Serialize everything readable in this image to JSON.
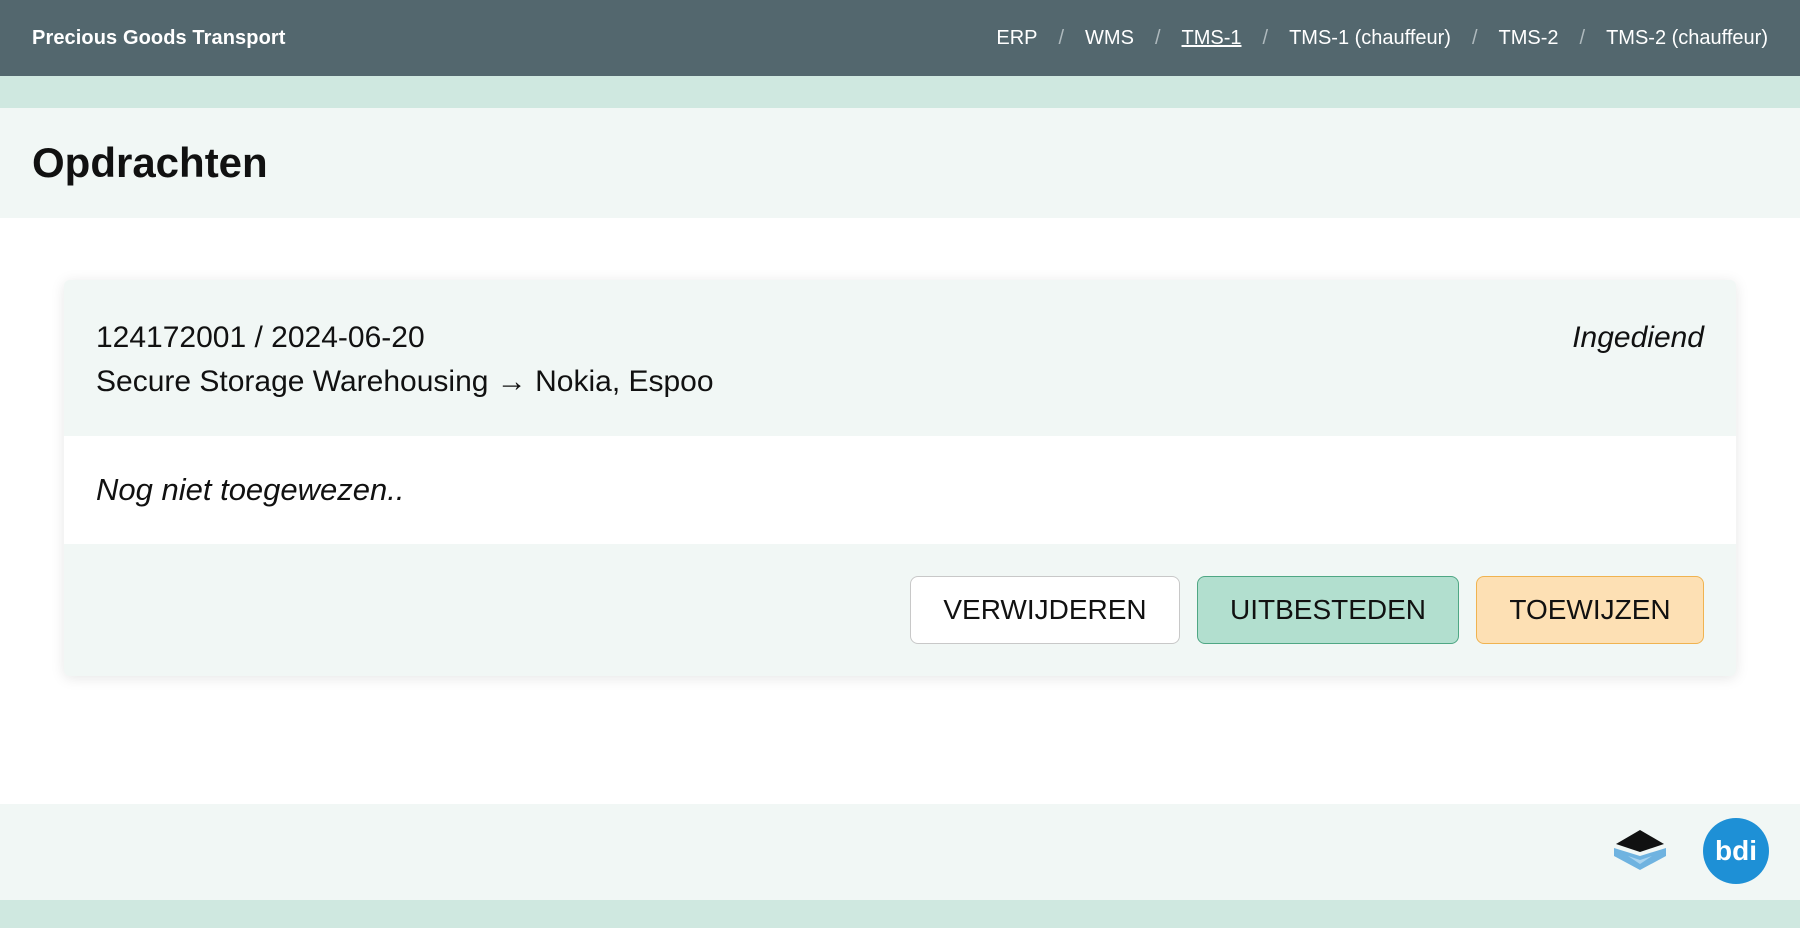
{
  "header": {
    "brand": "Precious Goods Transport",
    "nav": [
      {
        "label": "ERP",
        "active": false
      },
      {
        "label": "WMS",
        "active": false
      },
      {
        "label": "TMS-1",
        "active": true
      },
      {
        "label": "TMS-1 (chauffeur)",
        "active": false
      },
      {
        "label": "TMS-2",
        "active": false
      },
      {
        "label": "TMS-2 (chauffeur)",
        "active": false
      }
    ],
    "separator": "/"
  },
  "page": {
    "title": "Opdrachten"
  },
  "order": {
    "id_date": "124172001 / 2024-06-20",
    "route": "Secure Storage Warehousing → Nokia, Espoo",
    "status": "Ingediend",
    "assignment_text": "Nog niet toegewezen..",
    "actions": {
      "delete_label": "VERWIJDEREN",
      "outsource_label": "UITBESTEDEN",
      "assign_label": "TOEWIJZEN"
    }
  },
  "footer": {
    "logos": [
      {
        "icon": "layers-logo-icon",
        "colors": [
          "#111111",
          "#6fb3e0"
        ]
      },
      {
        "icon": "bdi-logo-icon",
        "text": "bdi",
        "color": "#1e90d6"
      }
    ]
  },
  "colors": {
    "topbar": "#53676e",
    "mint": "#cfe8e0",
    "panel": "#f1f7f5",
    "outsource": "#b2dfcf",
    "assign": "#fde0b4"
  }
}
